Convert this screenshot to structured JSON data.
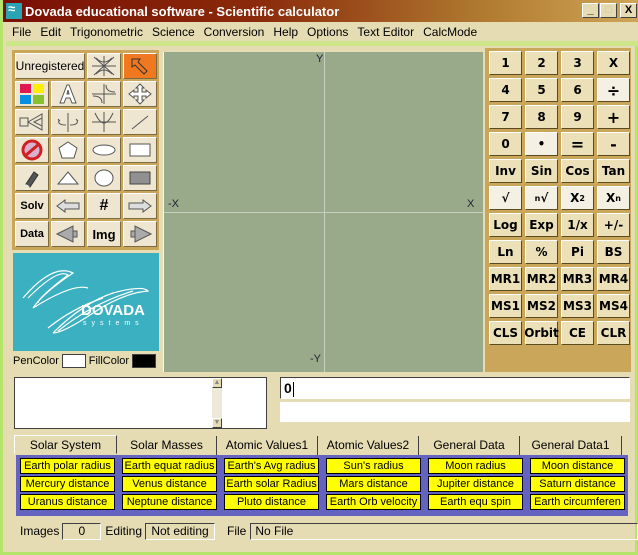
{
  "window": {
    "title": "Dovada educational software - Scientific calculator",
    "controls": {
      "minimize": "_",
      "maximize": "□",
      "close": "X"
    }
  },
  "menu": [
    "File",
    "Edit",
    "Trigonometric",
    "Science",
    "Conversion",
    "Help",
    "Options",
    "Text Editor",
    "CalcMode"
  ],
  "tools": {
    "unregistered_label": "Unregistered",
    "solv_label": "Solv",
    "data_label": "Data",
    "hash_label": "#",
    "img_label": "Img",
    "icons": [
      "axes-star-icon",
      "pointer-arrow-icon",
      "color-palette-icon",
      "text-a-icon",
      "hyperbola-icon",
      "move-arrows-icon",
      "camera-icon",
      "rotate-axis-icon",
      "parabola-icon",
      "line-icon",
      "no-entry-icon",
      "pentagon-icon",
      "ellipse-icon",
      "rectangle-icon",
      "eraser-icon",
      "triangle-icon",
      "circle-icon",
      "filled-rectangle-icon",
      "arrow-left-icon",
      "arrow-right-icon",
      "speaker-left-icon",
      "speaker-right-icon"
    ]
  },
  "logo": {
    "brand": "DOVADA",
    "tagline": "systems"
  },
  "colors": {
    "pen_label": "PenColor",
    "fill_label": "FillColor",
    "pen": "#ffffff",
    "fill": "#000000"
  },
  "canvas": {
    "y_label": "Y",
    "neg_y_label": "-Y",
    "x_label": "X",
    "neg_x_label": "-X"
  },
  "calc": {
    "rows": [
      [
        "1",
        "2",
        "3",
        "X"
      ],
      [
        "4",
        "5",
        "6",
        "÷"
      ],
      [
        "7",
        "8",
        "9",
        "+"
      ],
      [
        "0",
        "•",
        "=",
        "-"
      ],
      [
        "Inv",
        "Sin",
        "Cos",
        "Tan"
      ],
      [
        "√",
        "ⁿ√",
        "X²",
        "Xⁿ"
      ],
      [
        "Log",
        "Exp",
        "1/x",
        "+/-"
      ],
      [
        "Ln",
        "%",
        "Pi",
        "BS"
      ],
      [
        "MR1",
        "MR2",
        "MR3",
        "MR4"
      ],
      [
        "MS1",
        "MS2",
        "MS3",
        "MS4"
      ],
      [
        "CLS",
        "Orbit",
        "CE",
        "CLR"
      ]
    ]
  },
  "display": {
    "value": "0",
    "secondary": ""
  },
  "notes": {
    "value": ""
  },
  "tabs": [
    "Solar System",
    "Solar Masses",
    "Atomic Values1",
    "Atomic Values2",
    "General Data",
    "General Data1"
  ],
  "active_tab": "Solar System",
  "constants": [
    [
      "Earth polar radius",
      "Earth equat radius",
      "Earth's Avg radius",
      "Sun's radius",
      "Moon radius",
      "Moon distance"
    ],
    [
      "Mercury distance",
      "Venus distance",
      "Earth solar Radius",
      "Mars distance",
      "Jupiter distance",
      "Saturn distance"
    ],
    [
      "Uranus distance",
      "Neptune distance",
      "Pluto distance",
      "Earth Orb velocity",
      "Earth equ spin",
      "Earth circumferen"
    ]
  ],
  "status": {
    "images_label": "Images",
    "images_value": "0",
    "editing_label": "Editing",
    "editing_value": "Not editing",
    "file_label": "File",
    "file_value": "No File"
  }
}
